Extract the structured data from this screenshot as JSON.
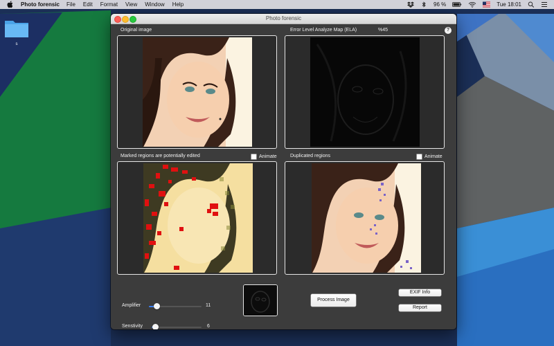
{
  "menubar": {
    "app_name": "Photo forensic",
    "menus": [
      "File",
      "Edit",
      "Format",
      "View",
      "Window",
      "Help"
    ],
    "battery": "96 %",
    "clock": "Tue 18:01"
  },
  "desktop": {
    "folder_label": "s"
  },
  "window": {
    "title": "Photo forensic"
  },
  "panels": {
    "original_label": "Original image",
    "ela_label": "Error Level Analyze Map (ELA)",
    "ela_percent": "%45",
    "marked_label": "Marked regions are potentially edited",
    "duplicated_label": "Duplicated regions",
    "animate_label": "Animate",
    "help": "?"
  },
  "controls": {
    "amplifier_label": "Amplifier",
    "amplifier_value": "11",
    "amplifier_fraction": 0.15,
    "sensitivity_label": "Senstivity",
    "sensitivity_value": "6",
    "sensitivity_fraction": 0.08,
    "process_button": "Process Image",
    "exif_button": "EXIF Info",
    "report_button": "Report"
  },
  "colors": {
    "slider_accent": "#3b7ff2",
    "marked_region": "#e01010",
    "duplicate_marker": "#7a63c8"
  }
}
